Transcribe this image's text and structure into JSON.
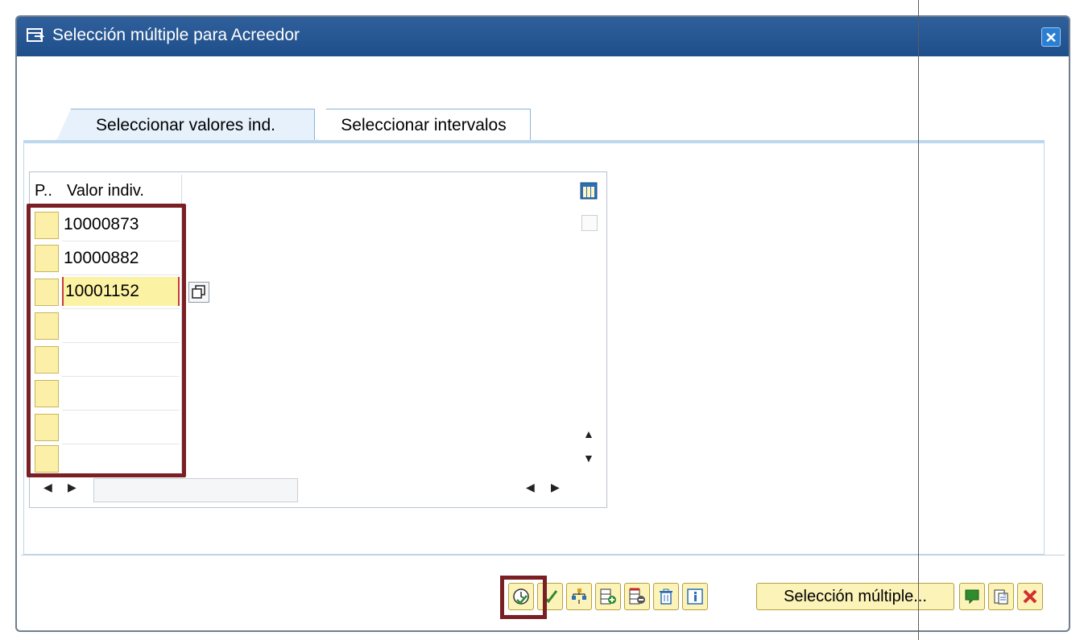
{
  "dialog": {
    "title": "Selección múltiple para Acreedor",
    "close_label": "✕"
  },
  "tabs": [
    {
      "label": "Seleccionar valores ind.",
      "active": true
    },
    {
      "label": "Seleccionar intervalos",
      "active": false
    }
  ],
  "table": {
    "columns": [
      "P..",
      "Valor indiv."
    ],
    "rows": [
      {
        "value": "10000873"
      },
      {
        "value": "10000882"
      },
      {
        "value": "10001152",
        "editing": true
      },
      {
        "value": ""
      },
      {
        "value": ""
      },
      {
        "value": ""
      },
      {
        "value": ""
      },
      {
        "value": ""
      }
    ]
  },
  "toolbar": {
    "buttons": [
      {
        "icon": "execute-clock-icon"
      },
      {
        "icon": "checkmark-icon"
      },
      {
        "icon": "hierarchy-icon"
      },
      {
        "icon": "insert-row-icon"
      },
      {
        "icon": "delete-row-icon"
      },
      {
        "icon": "trash-icon"
      },
      {
        "icon": "info-icon"
      }
    ],
    "multi_select_label": "Selección múltiple...",
    "trailing_buttons": [
      {
        "icon": "upload-icon"
      },
      {
        "icon": "clipboard-icon"
      },
      {
        "icon": "cancel-icon"
      }
    ]
  },
  "colors": {
    "title_bar": "#1f4f8a",
    "cell_yellow": "#fcf0a8",
    "highlight_red": "#7a1f24"
  }
}
